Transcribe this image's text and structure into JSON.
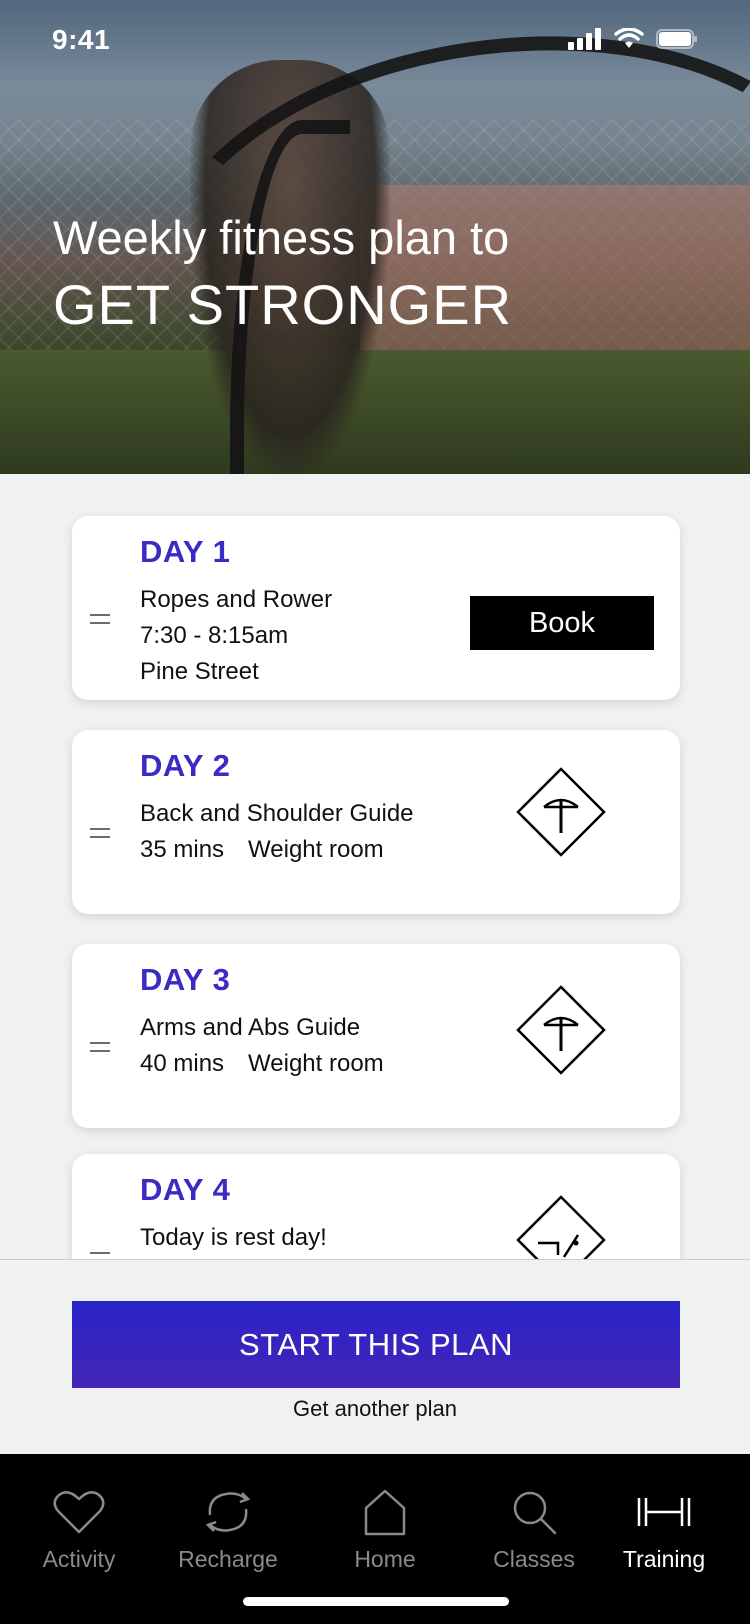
{
  "status": {
    "time": "9:41"
  },
  "hero": {
    "subtitle": "Weekly fitness plan to",
    "title": "GET STRONGER"
  },
  "plan": [
    {
      "day": "DAY 1",
      "lines": [
        "Ropes and Rower",
        "7:30 - 8:15am",
        "Pine Street"
      ],
      "action": "Book"
    },
    {
      "day": "DAY 2",
      "line1": "Back and Shoulder Guide",
      "duration": "35 mins",
      "location": "Weight room",
      "icon": "dumbbell-diamond-icon"
    },
    {
      "day": "DAY 3",
      "line1": "Arms and Abs Guide",
      "duration": "40 mins",
      "location": "Weight room",
      "icon": "dumbbell-diamond-icon"
    },
    {
      "day": "DAY 4",
      "line1": "Today is rest day!",
      "icon": "rest-diamond-icon"
    }
  ],
  "cta": {
    "start_label": "START THIS PLAN",
    "another_label": "Get another plan"
  },
  "tabbar": {
    "items": [
      {
        "label": "Activity",
        "icon": "heart-icon"
      },
      {
        "label": "Recharge",
        "icon": "recharge-icon"
      },
      {
        "label": "Home",
        "icon": "home-icon"
      },
      {
        "label": "Classes",
        "icon": "search-icon"
      },
      {
        "label": "Training",
        "icon": "barbell-icon",
        "active": true
      }
    ]
  },
  "colors": {
    "accent": "#3a2bc4",
    "cta": "#2f23c4",
    "tabbar_bg": "#000000",
    "tab_inactive": "#8a8a8a"
  }
}
